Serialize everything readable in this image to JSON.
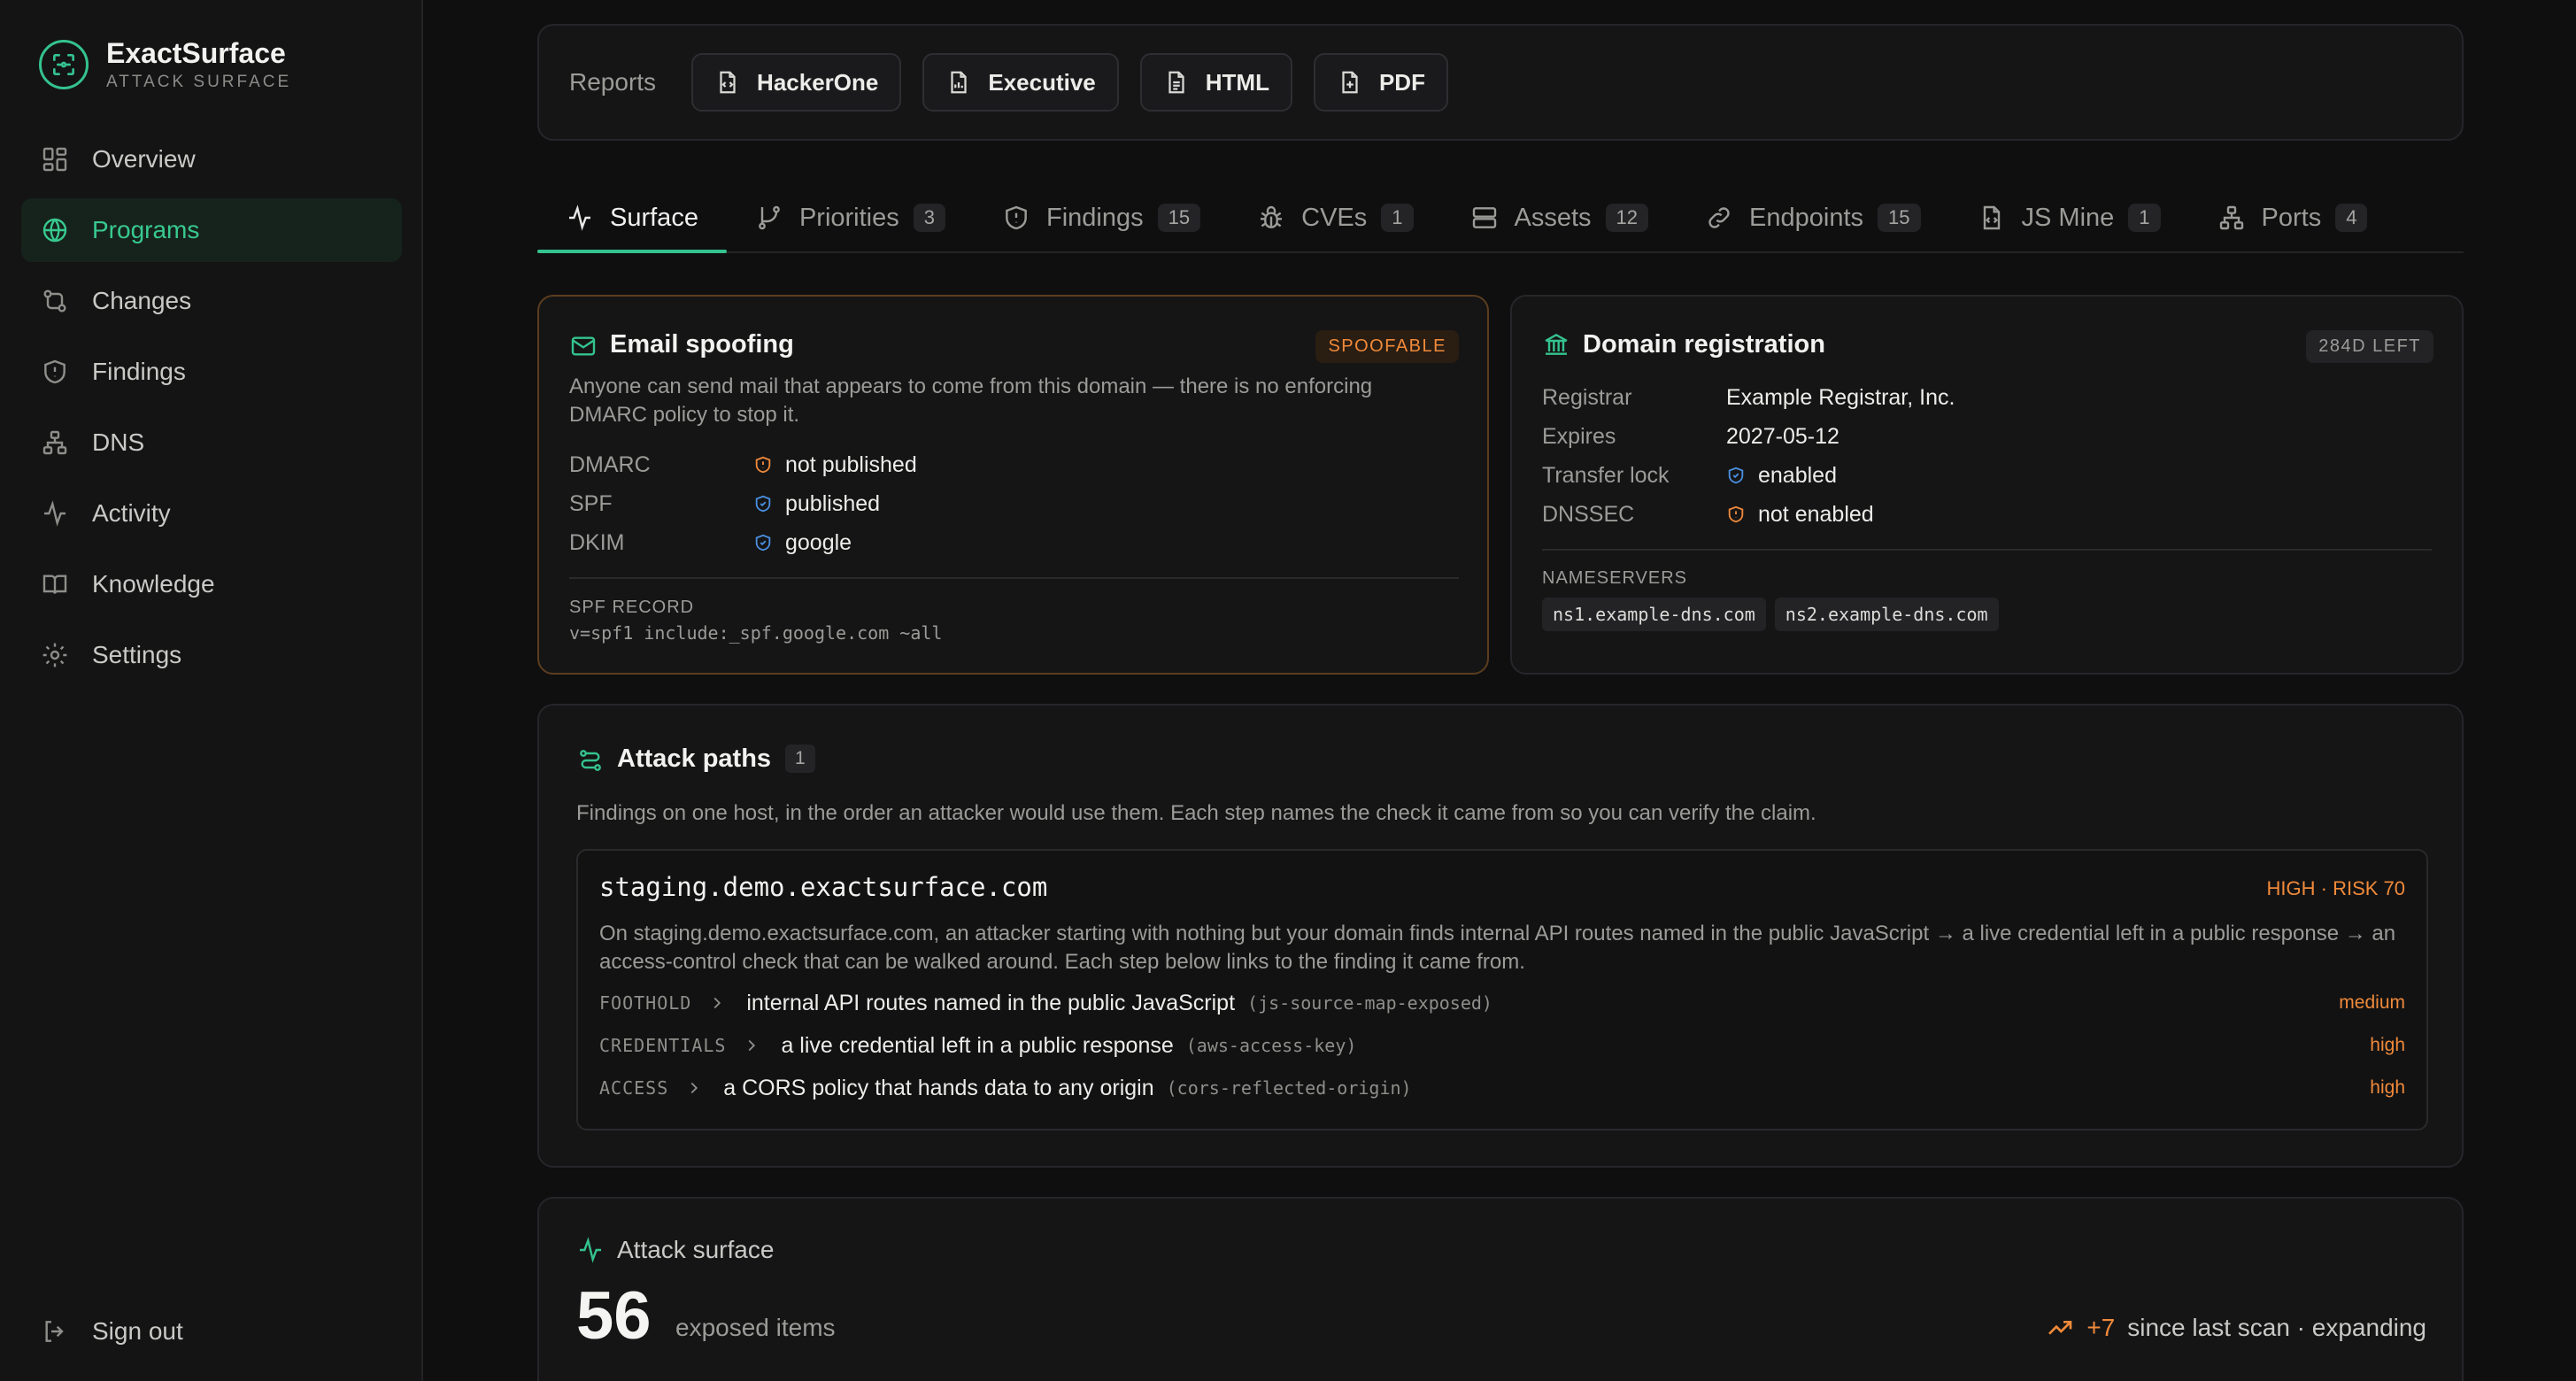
{
  "brand": {
    "name": "ExactSurface",
    "subtitle": "ATTACK SURFACE"
  },
  "sidebar": {
    "items": [
      {
        "label": "Overview",
        "icon": "grid-icon"
      },
      {
        "label": "Programs",
        "icon": "globe-icon",
        "active": true
      },
      {
        "label": "Changes",
        "icon": "git-compare-icon"
      },
      {
        "label": "Findings",
        "icon": "shield-icon"
      },
      {
        "label": "DNS",
        "icon": "network-icon"
      },
      {
        "label": "Activity",
        "icon": "activity-icon"
      },
      {
        "label": "Knowledge",
        "icon": "book-icon"
      },
      {
        "label": "Settings",
        "icon": "gear-icon"
      }
    ],
    "signout": "Sign out"
  },
  "reports": {
    "label": "Reports",
    "buttons": [
      "HackerOne",
      "Executive",
      "HTML",
      "PDF"
    ]
  },
  "tabs": [
    {
      "label": "Surface",
      "count": ""
    },
    {
      "label": "Priorities",
      "count": "3"
    },
    {
      "label": "Findings",
      "count": "15"
    },
    {
      "label": "CVEs",
      "count": "1"
    },
    {
      "label": "Assets",
      "count": "12"
    },
    {
      "label": "Endpoints",
      "count": "15"
    },
    {
      "label": "JS Mine",
      "count": "1"
    },
    {
      "label": "Ports",
      "count": "4"
    }
  ],
  "email": {
    "title": "Email spoofing",
    "badge": "SPOOFABLE",
    "description": "Anyone can send mail that appears to come from this domain — there is no enforcing DMARC policy to stop it.",
    "rows": [
      {
        "key": "DMARC",
        "value": "not published",
        "status": "warn"
      },
      {
        "key": "SPF",
        "value": "published",
        "status": "ok"
      },
      {
        "key": "DKIM",
        "value": "google",
        "status": "ok"
      }
    ],
    "spf_label": "SPF RECORD",
    "spf_value": "v=spf1 include:_spf.google.com ~all"
  },
  "domain": {
    "title": "Domain registration",
    "badge": "284D LEFT",
    "rows": [
      {
        "key": "Registrar",
        "value": "Example Registrar, Inc."
      },
      {
        "key": "Expires",
        "value": "2027-05-12"
      },
      {
        "key": "Transfer lock",
        "value": "enabled",
        "status": "ok"
      },
      {
        "key": "DNSSEC",
        "value": "not enabled",
        "status": "warn"
      }
    ],
    "ns_label": "NAMESERVERS",
    "nameservers": [
      "ns1.example-dns.com",
      "ns2.example-dns.com"
    ]
  },
  "attack_paths": {
    "title": "Attack paths",
    "count": "1",
    "description": "Findings on one host, in the order an attacker would use them. Each step names the check it came from so you can verify the claim.",
    "path": {
      "host": "staging.demo.exactsurface.com",
      "risk": "HIGH · RISK 70",
      "summary": "On staging.demo.exactsurface.com, an attacker starting with nothing but your domain finds internal API routes named in the public JavaScript → a live credential left in a public response → an access-control check that can be walked around. Each step below links to the finding it came from.",
      "steps": [
        {
          "stage": "FOOTHOLD",
          "text": "internal API routes named in the public JavaScript",
          "check": "(js-source-map-exposed)",
          "severity": "medium"
        },
        {
          "stage": "CREDENTIALS",
          "text": "a live credential left in a public response",
          "check": "(aws-access-key)",
          "severity": "high"
        },
        {
          "stage": "ACCESS",
          "text": "a CORS policy that hands data to any origin",
          "check": "(cors-reflected-origin)",
          "severity": "high"
        }
      ]
    }
  },
  "surface": {
    "title": "Attack surface",
    "count": "56",
    "count_label": "exposed items",
    "delta": "+7",
    "delta_label": "since last scan · expanding"
  },
  "colors": {
    "accent": "#34c38f",
    "warn": "#f08a3a",
    "ok": "#4a8fe0"
  }
}
